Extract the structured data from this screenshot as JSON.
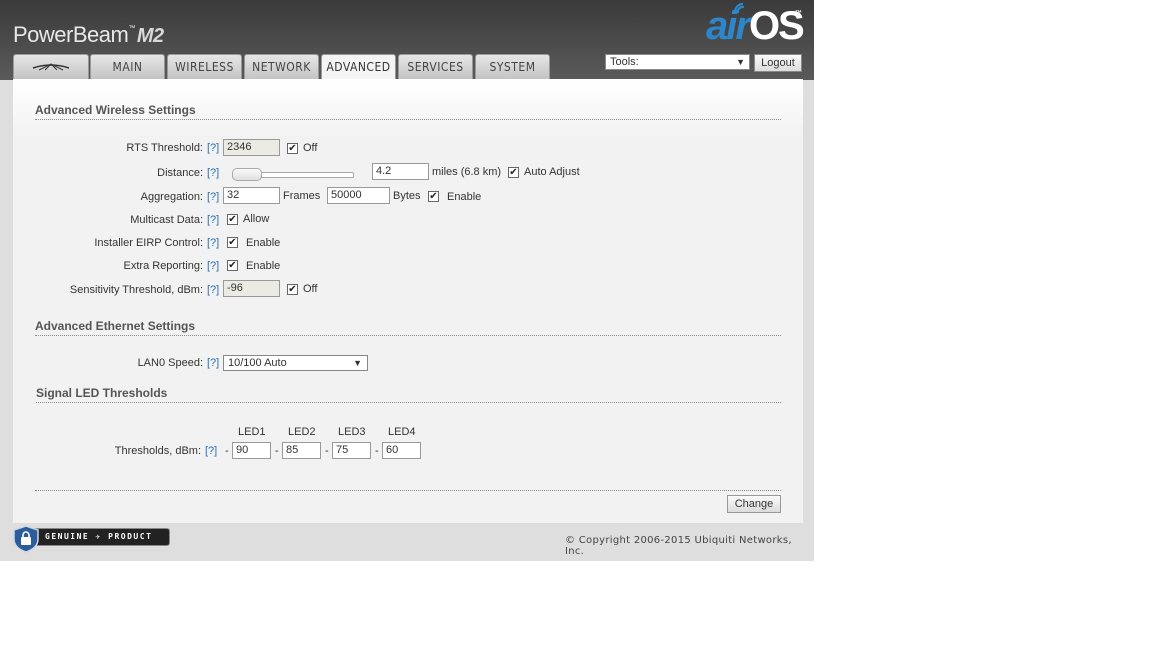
{
  "header": {
    "brand": "PowerBeam",
    "brand_tm": "™",
    "model": "M2",
    "logo_air": "air",
    "logo_os": "OS",
    "logo_tm": "™"
  },
  "tabs": [
    {
      "label": "",
      "icon": "ubiquiti-logo-icon"
    },
    {
      "label": "MAIN"
    },
    {
      "label": "WIRELESS"
    },
    {
      "label": "NETWORK"
    },
    {
      "label": "ADVANCED",
      "active": true
    },
    {
      "label": "SERVICES"
    },
    {
      "label": "SYSTEM"
    }
  ],
  "tools": {
    "value": "Tools:"
  },
  "logout_label": "Logout",
  "help_label": "[?]",
  "wireless": {
    "title": "Advanced Wireless Settings",
    "rts_label": "RTS Threshold:",
    "rts_value": "2346",
    "rts_off_label": "Off",
    "distance_label": "Distance:",
    "distance_value": "4.2",
    "distance_units": "miles (6.8 km)",
    "auto_adjust_label": "Auto Adjust",
    "aggregation_label": "Aggregation:",
    "agg_frames_value": "32",
    "agg_frames_label": "Frames",
    "agg_bytes_value": "50000",
    "agg_bytes_label": "Bytes",
    "agg_enable_label": "Enable",
    "multicast_label": "Multicast Data:",
    "multicast_allow_label": "Allow",
    "eirp_label": "Installer EIRP Control:",
    "eirp_enable_label": "Enable",
    "extra_label": "Extra Reporting:",
    "extra_enable_label": "Enable",
    "sensitivity_label": "Sensitivity Threshold, dBm:",
    "sensitivity_value": "-96",
    "sensitivity_off_label": "Off"
  },
  "ethernet": {
    "title": "Advanced Ethernet Settings",
    "lan0_label": "LAN0 Speed:",
    "lan0_value": "10/100 Auto"
  },
  "led": {
    "title": "Signal LED Thresholds",
    "headers": [
      "LED1",
      "LED2",
      "LED3",
      "LED4"
    ],
    "label": "Thresholds, dBm:",
    "values": [
      "90",
      "85",
      "75",
      "60"
    ],
    "dash": "-"
  },
  "change_label": "Change",
  "footer": {
    "badge_text": "GENUINE ✈ PRODUCT",
    "copyright": "© Copyright 2006-2015 Ubiquiti Networks, Inc."
  },
  "colors": {
    "accent": "#2b86cc",
    "header_bg": "#3a3a3a",
    "help_link": "#2a6fb0"
  }
}
